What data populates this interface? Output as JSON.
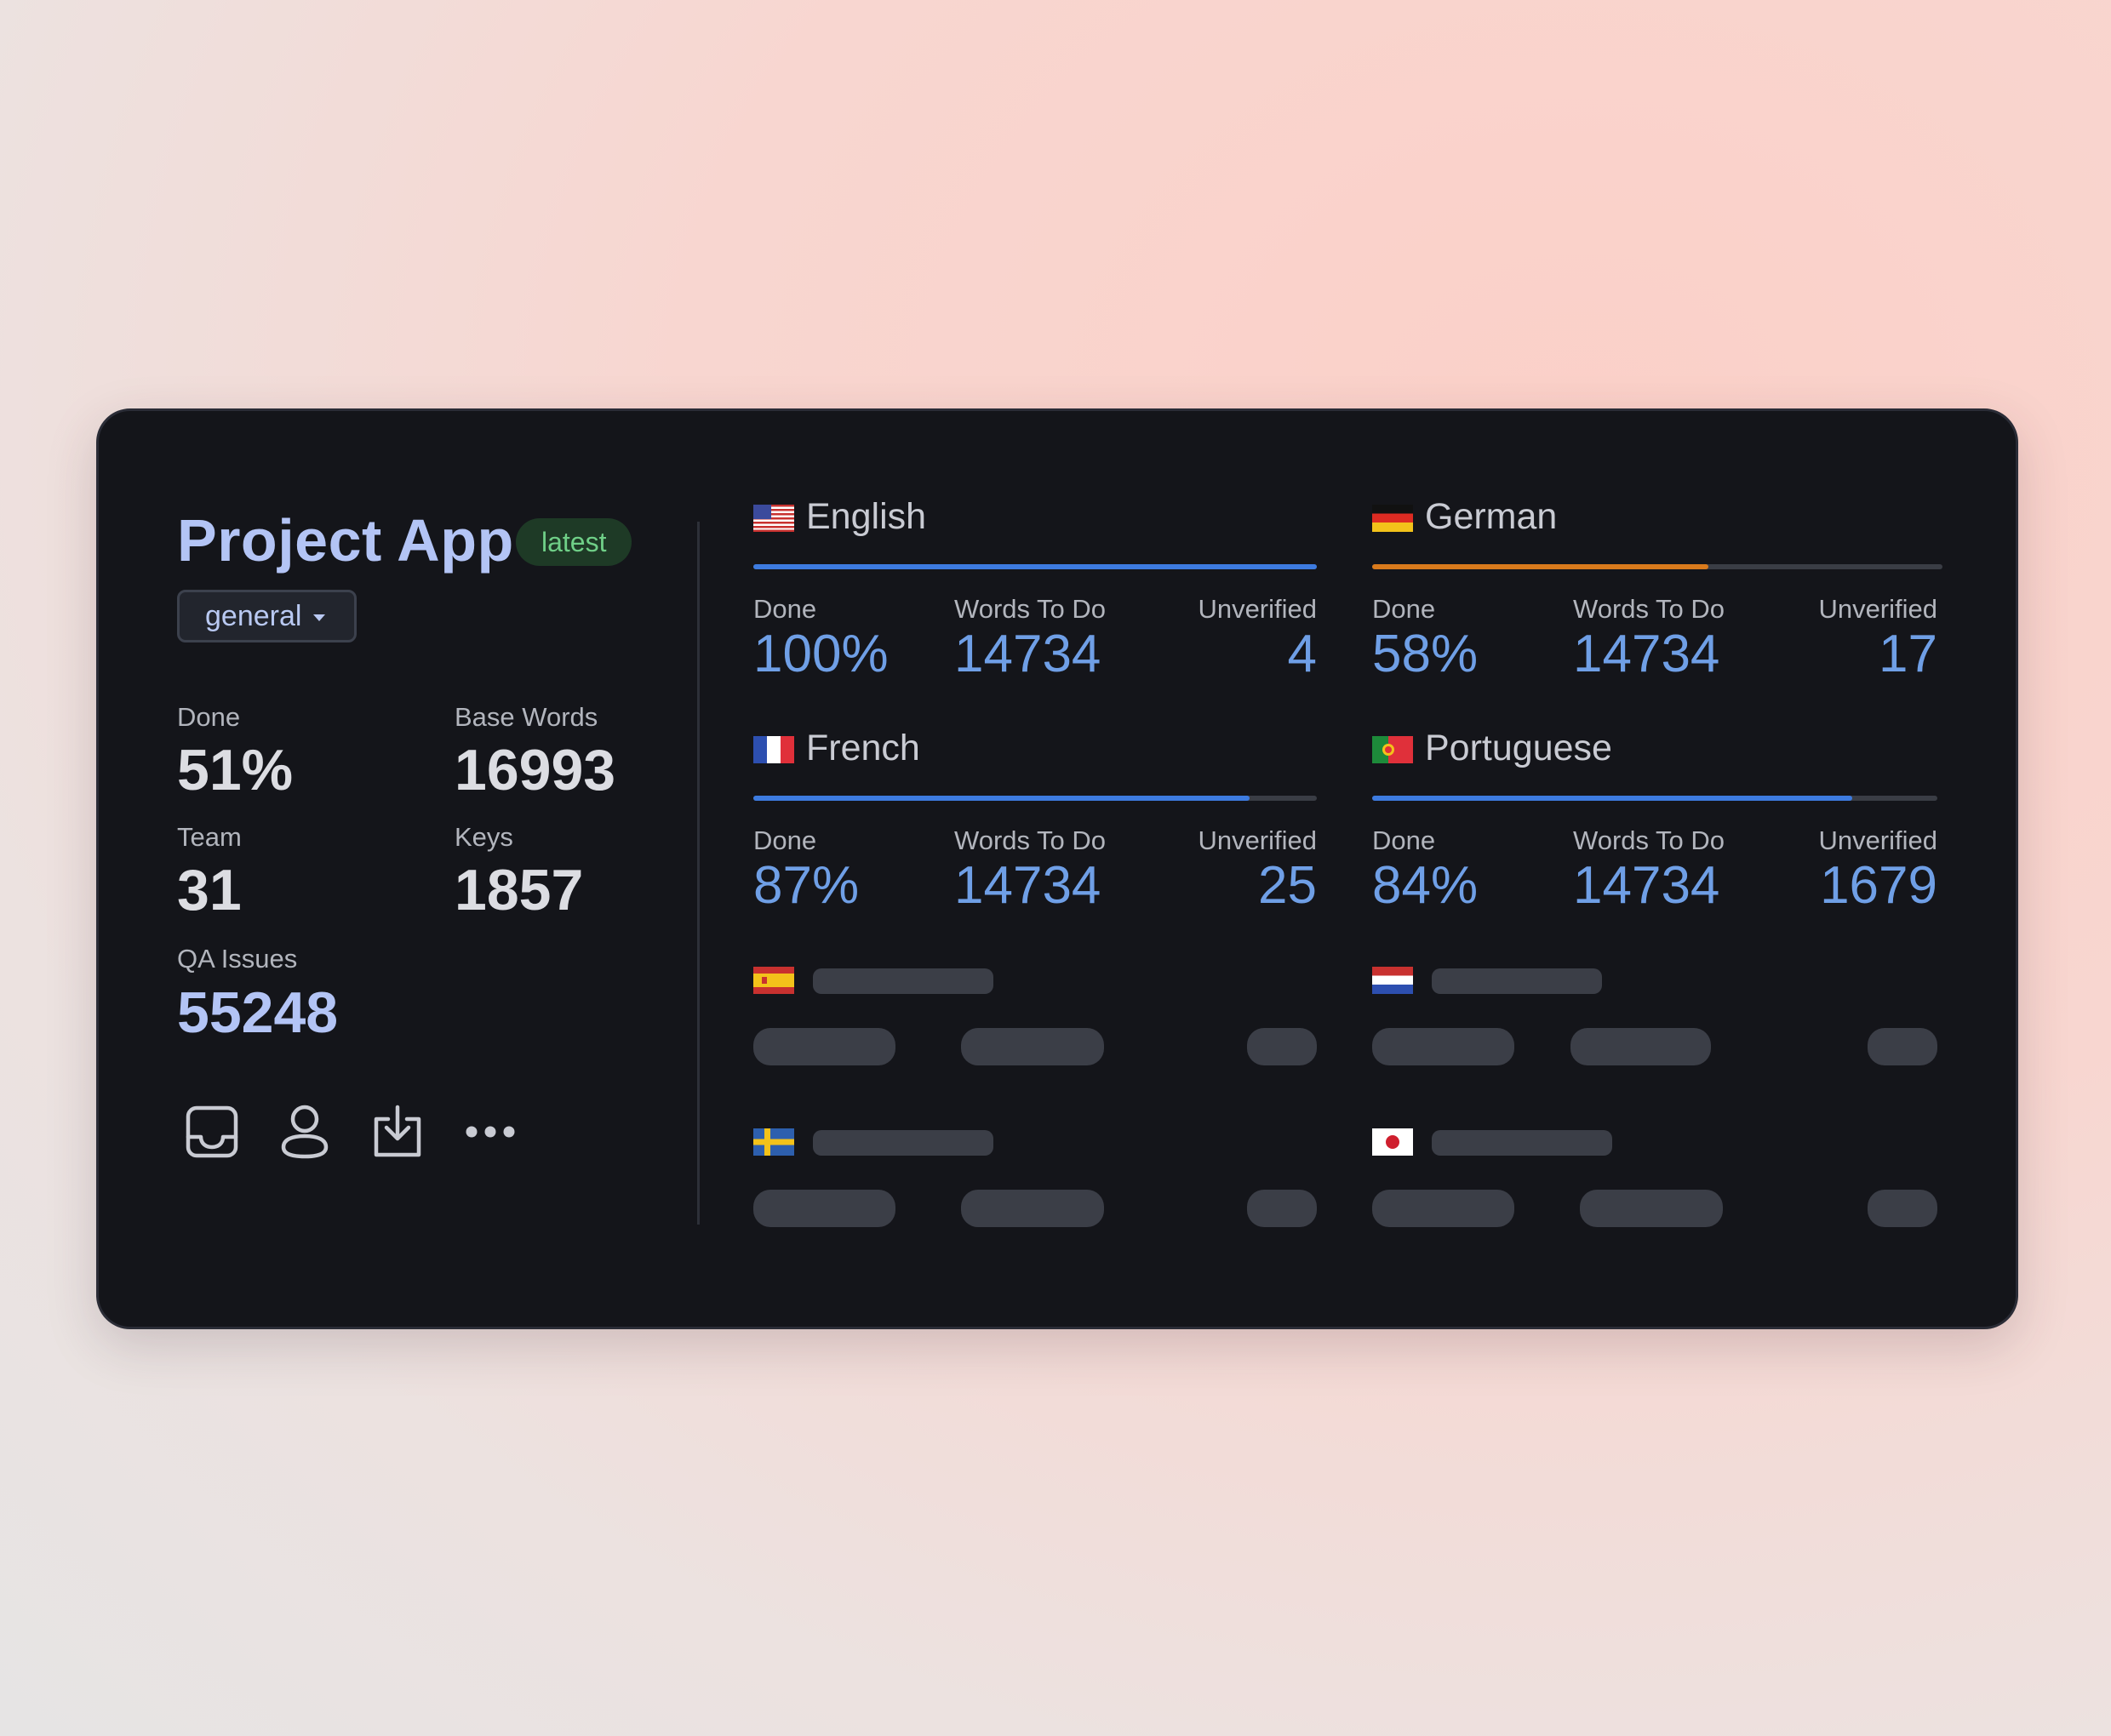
{
  "project": {
    "title": "Project App",
    "badge": "latest",
    "branch": "general"
  },
  "stats": {
    "done_label": "Done",
    "done_value": "51%",
    "base_words_label": "Base Words",
    "base_words_value": "16993",
    "team_label": "Team",
    "team_value": "31",
    "keys_label": "Keys",
    "keys_value": "1857",
    "qa_label": "QA Issues",
    "qa_value": "55248"
  },
  "actions": [
    "inbox-icon",
    "user-icon",
    "download-icon",
    "more-icon"
  ],
  "languages": [
    {
      "name": "English",
      "flag": "us-flag-icon",
      "progress": 1.0,
      "bar_color": "#3d7be0",
      "done_label": "Done",
      "done": "100%",
      "words_label": "Words To Do",
      "words": "14734",
      "unverified_label": "Unverified",
      "unverified": "4"
    },
    {
      "name": "German",
      "flag": "de-flag-icon",
      "progress": 0.59,
      "bar_color": "#d97a1c",
      "done_label": "Done",
      "done": "58%",
      "words_label": "Words To Do",
      "words": "14734",
      "unverified_label": "Unverified",
      "unverified": "17"
    },
    {
      "name": "French",
      "flag": "fr-flag-icon",
      "progress": 0.88,
      "bar_color": "#3d7be0",
      "done_label": "Done",
      "done": "87%",
      "words_label": "Words To Do",
      "words": "14734",
      "unverified_label": "Unverified",
      "unverified": "25"
    },
    {
      "name": "Portuguese",
      "flag": "pt-flag-icon",
      "progress": 0.85,
      "bar_color": "#3d7be0",
      "done_label": "Done",
      "done": "84%",
      "words_label": "Words To Do",
      "words": "14734",
      "unverified_label": "Unverified",
      "unverified": "1679"
    }
  ],
  "loading_languages": [
    "es-flag-icon",
    "nl-flag-icon",
    "se-flag-icon",
    "jp-flag-icon"
  ],
  "colors": {
    "accent": "#6f9fe6",
    "title": "#b3c4f5",
    "badge_bg": "#1e3a26",
    "badge_text": "#6fcf87",
    "card_bg": "#14151a"
  }
}
